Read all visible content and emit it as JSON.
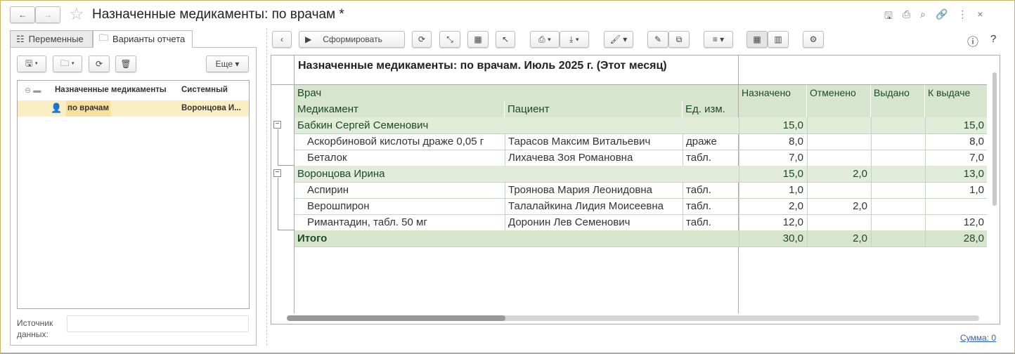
{
  "window": {
    "title": "Назначенные медикаменты: по врачам *"
  },
  "left": {
    "tabs": [
      "Переменные",
      "Варианты отчета"
    ],
    "more_label": "Еще",
    "list_header": {
      "name": "Назначенные медикаменты",
      "author": "Системный"
    },
    "list_items": [
      {
        "name": "по врачам",
        "author": "Воронцова И..."
      }
    ],
    "source_label": "Источник данных:",
    "source_value": ""
  },
  "toolbar": {
    "generate_label": "Сформировать"
  },
  "report": {
    "title": "Назначенные медикаменты: по врачам. Июль 2025 г. (Этот месяц)",
    "headers": {
      "doctor": "Врач",
      "medicine": "Медикамент",
      "patient": "Пациент",
      "unit": "Ед. изм.",
      "assigned": "Назначено",
      "cancelled": "Отменено",
      "issued": "Выдано",
      "to_issue": "К выдаче"
    },
    "groups": [
      {
        "doctor": "Бабкин Сергей Семенович",
        "assigned": "15,0",
        "cancelled": "",
        "issued": "",
        "to_issue": "15,0",
        "rows": [
          {
            "medicine": "Аскорбиновой кислоты драже 0,05 г",
            "patient": "Тарасов Максим Витальевич",
            "unit": "драже",
            "assigned": "8,0",
            "cancelled": "",
            "issued": "",
            "to_issue": "8,0"
          },
          {
            "medicine": "Беталок",
            "patient": "Лихачева Зоя Романовна",
            "unit": "табл.",
            "assigned": "7,0",
            "cancelled": "",
            "issued": "",
            "to_issue": "7,0"
          }
        ]
      },
      {
        "doctor": "Воронцова Ирина",
        "assigned": "15,0",
        "cancelled": "2,0",
        "issued": "",
        "to_issue": "13,0",
        "rows": [
          {
            "medicine": "Аспирин",
            "patient": "Троянова Мария Леонидовна",
            "unit": "табл.",
            "assigned": "1,0",
            "cancelled": "",
            "issued": "",
            "to_issue": "1,0"
          },
          {
            "medicine": "Верошпирон",
            "patient": "Талалайкина Лидия Моисеевна",
            "unit": "табл.",
            "assigned": "2,0",
            "cancelled": "2,0",
            "issued": "",
            "to_issue": ""
          },
          {
            "medicine": "Римантадин, табл. 50 мг",
            "patient": "Доронин Лев Семенович",
            "unit": "табл.",
            "assigned": "12,0",
            "cancelled": "",
            "issued": "",
            "to_issue": "12,0"
          }
        ]
      }
    ],
    "total": {
      "label": "Итого",
      "assigned": "30,0",
      "cancelled": "2,0",
      "issued": "",
      "to_issue": "28,0"
    }
  },
  "footer": {
    "sum_label": "Сумма: 0"
  }
}
